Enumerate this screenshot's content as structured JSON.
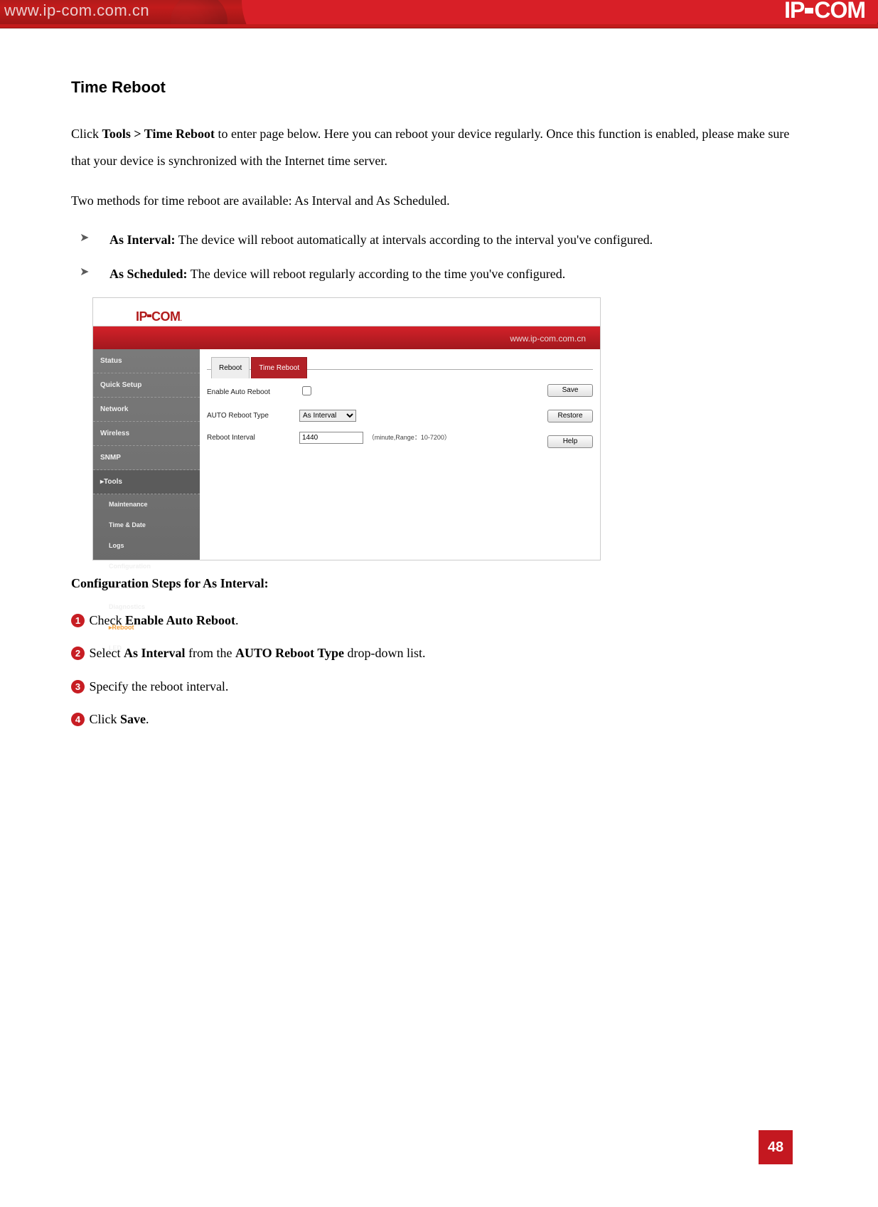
{
  "banner": {
    "url": "www.ip-com.com.cn",
    "logo": "IP-COM"
  },
  "doc": {
    "section_title": "Time Reboot",
    "intro_prefix": "Click ",
    "intro_bold": "Tools > Time Reboot",
    "intro_suffix": " to enter page below. Here you can reboot your device regularly. Once this function is enabled, please make sure that your device is synchronized with the Internet time server.",
    "methods_line": "Two methods for time reboot are available: As Interval and As Scheduled.",
    "bullets": [
      {
        "bold": "As Interval:",
        "text": " The device will reboot automatically at intervals according to the interval you've configured."
      },
      {
        "bold": "As Scheduled:",
        "text": " The device will reboot regularly according to the time you've configured."
      }
    ],
    "steps_title": "Configuration Steps for As Interval:",
    "steps": [
      {
        "num": "1",
        "pre": " Check ",
        "bold": "Enable Auto Reboot",
        "post": "."
      },
      {
        "num": "2",
        "pre": " Select ",
        "bold": "As Interval",
        "mid": " from the ",
        "bold2": "AUTO Reboot Type",
        "post": " drop-down list."
      },
      {
        "num": "3",
        "pre": " Specify the reboot interval.",
        "bold": "",
        "post": ""
      },
      {
        "num": "4",
        "pre": " Click ",
        "bold": "Save",
        "post": "."
      }
    ]
  },
  "embed": {
    "logo": "IP-COM",
    "header_url": "www.ip-com.com.cn",
    "nav": {
      "items": [
        "Status",
        "Quick Setup",
        "Network",
        "Wireless",
        "SNMP",
        "Tools"
      ],
      "tools_sub": [
        "Maintenance",
        "Time & Date",
        "Logs",
        "Configuration",
        "Username & Password",
        "Diagnostics",
        "Reboot",
        "LED"
      ]
    },
    "tabs": {
      "reboot": "Reboot",
      "time_reboot": "Time Reboot"
    },
    "form": {
      "enable_label": "Enable Auto Reboot",
      "type_label": "AUTO Reboot Type",
      "type_value": "As Interval",
      "interval_label": "Reboot Interval",
      "interval_value": "1440",
      "interval_hint": "（minute,Range：10-7200）"
    },
    "buttons": {
      "save": "Save",
      "restore": "Restore",
      "help": "Help"
    }
  },
  "page_number": "48"
}
